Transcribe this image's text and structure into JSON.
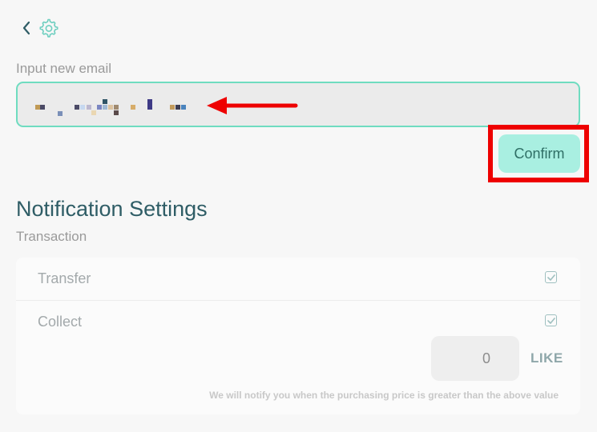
{
  "nav": {
    "back_icon": "chevron-left-icon",
    "settings_icon": "gear-icon"
  },
  "email": {
    "label": "Input new email",
    "value_redacted": true
  },
  "confirm": {
    "label": "Confirm"
  },
  "notifications": {
    "title": "Notification Settings",
    "subtitle": "Transaction",
    "rows": [
      {
        "label": "Transfer",
        "checked": true
      },
      {
        "label": "Collect",
        "checked": true
      }
    ],
    "price_threshold": {
      "value": "0",
      "unit": "LIKE",
      "note": "We will notify you when the purchasing price is greater than the above value"
    }
  },
  "colors": {
    "accent": "#6fdcc0",
    "confirm_bg": "#a9efe1",
    "heading": "#2f5d66",
    "annotation": "#ee0000"
  }
}
